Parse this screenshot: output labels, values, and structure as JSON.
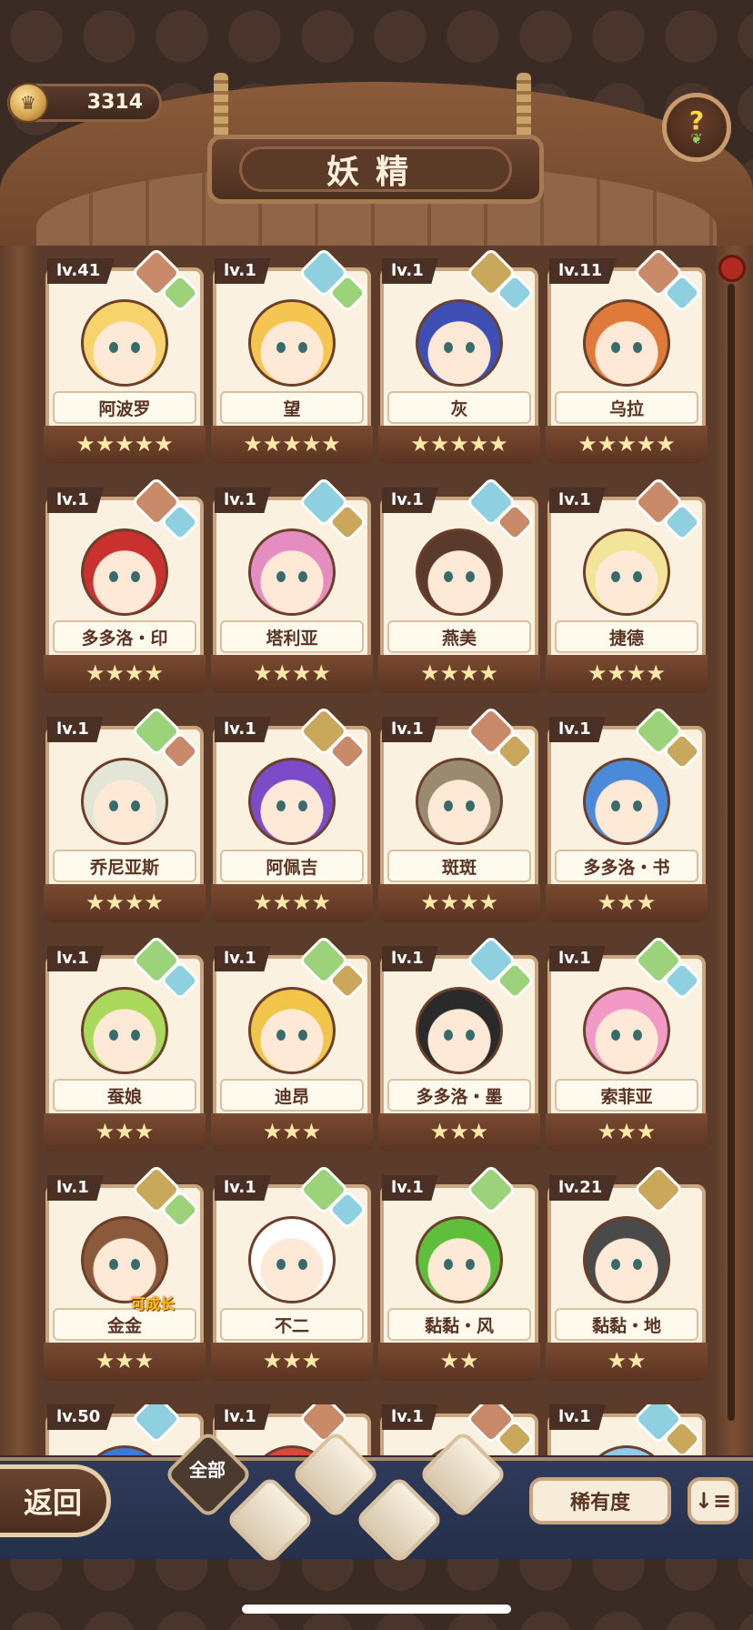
{
  "currency": {
    "amount": "3314",
    "icon": "crown-coin-icon"
  },
  "title": "妖精",
  "help": {
    "mark": "?",
    "icon": "sprout-icon"
  },
  "cards": [
    {
      "level": "lv.41",
      "name": "阿波罗",
      "stars": "★★★★★",
      "elements": [
        "fire",
        "leaf"
      ],
      "color": "#f6d36b"
    },
    {
      "level": "lv.1",
      "name": "望",
      "stars": "★★★★★",
      "elements": [
        "water",
        "leaf"
      ],
      "color": "#f4c550"
    },
    {
      "level": "lv.1",
      "name": "灰",
      "stars": "★★★★★",
      "elements": [
        "earth",
        "water"
      ],
      "color": "#3d4fb5"
    },
    {
      "level": "lv.11",
      "name": "乌拉",
      "stars": "★★★★★",
      "elements": [
        "fire",
        "water"
      ],
      "color": "#e07a3a"
    },
    {
      "level": "lv.1",
      "name": "多多洛・印",
      "stars": "★★★★",
      "elements": [
        "fire",
        "water"
      ],
      "color": "#c8312e"
    },
    {
      "level": "lv.1",
      "name": "塔利亚",
      "stars": "★★★★",
      "elements": [
        "water",
        "earth"
      ],
      "color": "#e58cc0"
    },
    {
      "level": "lv.1",
      "name": "燕美",
      "stars": "★★★★",
      "elements": [
        "water",
        "fire"
      ],
      "color": "#5a3a2a"
    },
    {
      "level": "lv.1",
      "name": "捷德",
      "stars": "★★★★",
      "elements": [
        "fire",
        "water"
      ],
      "color": "#f2e59a"
    },
    {
      "level": "lv.1",
      "name": "乔尼亚斯",
      "stars": "★★★★",
      "elements": [
        "leaf",
        "fire"
      ],
      "color": "#e3e6d6"
    },
    {
      "level": "lv.1",
      "name": "阿佩吉",
      "stars": "★★★★",
      "elements": [
        "earth",
        "fire"
      ],
      "color": "#7b4bc8"
    },
    {
      "level": "lv.1",
      "name": "斑斑",
      "stars": "★★★★",
      "elements": [
        "fire",
        "earth"
      ],
      "color": "#9a8a70"
    },
    {
      "level": "lv.1",
      "name": "多多洛・书",
      "stars": "★★★",
      "elements": [
        "leaf",
        "earth"
      ],
      "color": "#4a8ad8"
    },
    {
      "level": "lv.1",
      "name": "蚕娘",
      "stars": "★★★",
      "elements": [
        "leaf",
        "water"
      ],
      "color": "#a9d85a"
    },
    {
      "level": "lv.1",
      "name": "迪昂",
      "stars": "★★★",
      "elements": [
        "leaf",
        "earth"
      ],
      "color": "#f0c54a"
    },
    {
      "level": "lv.1",
      "name": "多多洛・墨",
      "stars": "★★★",
      "elements": [
        "water",
        "leaf"
      ],
      "color": "#2a2a2a"
    },
    {
      "level": "lv.1",
      "name": "索菲亚",
      "stars": "★★★",
      "elements": [
        "leaf",
        "water"
      ],
      "color": "#f29ac6"
    },
    {
      "level": "lv.1",
      "name": "金金",
      "stars": "★★★",
      "elements": [
        "earth",
        "leaf"
      ],
      "color": "#8a5a3a",
      "badge": "可成长"
    },
    {
      "level": "lv.1",
      "name": "不二",
      "stars": "★★★",
      "elements": [
        "leaf",
        "water"
      ],
      "color": "#ffffff"
    },
    {
      "level": "lv.1",
      "name": "黏黏・风",
      "stars": "★★",
      "elements": [
        "leaf"
      ],
      "color": "#5fbf3c"
    },
    {
      "level": "lv.21",
      "name": "黏黏・地",
      "stars": "★★",
      "elements": [
        "earth"
      ],
      "color": "#4a4a4a"
    },
    {
      "level": "lv.50",
      "name": "",
      "stars": "",
      "elements": [
        "water"
      ],
      "color": "#3a7ad8"
    },
    {
      "level": "lv.1",
      "name": "",
      "stars": "",
      "elements": [
        "fire"
      ],
      "color": "#d8483a"
    },
    {
      "level": "lv.1",
      "name": "",
      "stars": "",
      "elements": [
        "fire",
        "earth"
      ],
      "color": "#e8783a"
    },
    {
      "level": "lv.1",
      "name": "",
      "stars": "",
      "elements": [
        "water",
        "earth"
      ],
      "color": "#8fc8e8"
    }
  ],
  "bottom": {
    "back": "返回",
    "filter_all": "全部",
    "filters": [
      "leaf",
      "water",
      "earth",
      "fire"
    ],
    "rarity": "稀有度",
    "sort_icon": "sort-icon",
    "sort_glyph": "↓≡"
  }
}
